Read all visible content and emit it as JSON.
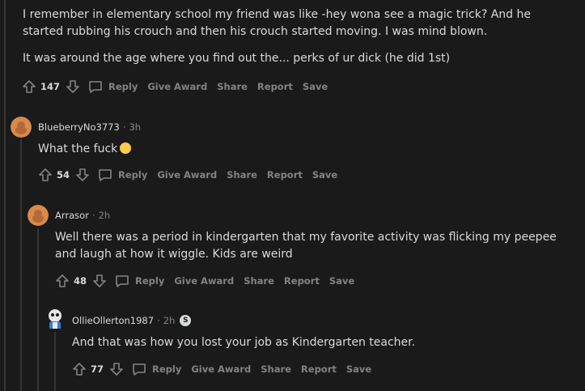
{
  "comments": [
    {
      "paragraphs": [
        "I remember in elementary school my friend was like -hey wona see a magic trick? And he started rubbing his crouch and then his crouch started moving. I was mind blown.",
        "It was around the age where you find out the... perks of ur dick (he did 1st)"
      ],
      "score": "147",
      "actions": [
        "Reply",
        "Give Award",
        "Share",
        "Report",
        "Save"
      ]
    },
    {
      "author": "BlueberryNo3773",
      "time": "3h",
      "text": "What the fuck",
      "emoji": "rolling-on-floor-laughing-emoji",
      "score": "54",
      "actions": [
        "Reply",
        "Give Award",
        "Share",
        "Report",
        "Save"
      ]
    },
    {
      "author": "Arrasor",
      "time": "2h",
      "text": "Well there was a period in kindergarten that my favorite activity was flicking my peepee and laugh at how it wiggle. Kids are weird",
      "score": "48",
      "actions": [
        "Reply",
        "Give Award",
        "Share",
        "Report",
        "Save"
      ]
    },
    {
      "author": "OllieOllerton1987",
      "time": "2h",
      "badge": "S",
      "text": "And that was how you lost your job as Kindergarten teacher.",
      "score": "77",
      "actions": [
        "Reply",
        "Give Award",
        "Share",
        "Report",
        "Save"
      ]
    }
  ],
  "separator": "·"
}
